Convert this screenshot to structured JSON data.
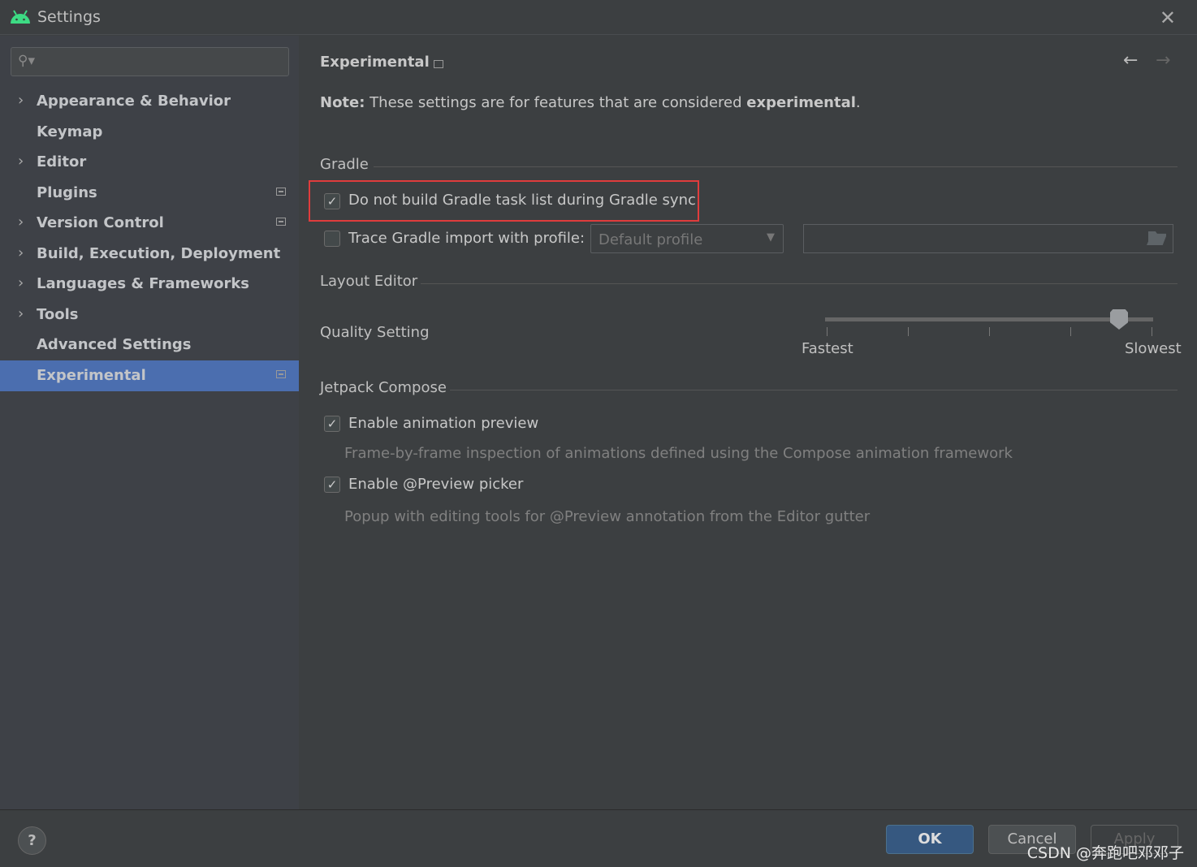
{
  "window": {
    "title": "Settings",
    "close_icon": "close-icon",
    "logo": "android-icon",
    "accent": "#3ddc84"
  },
  "sidebar": {
    "search_placeholder": "",
    "items": [
      {
        "label": "Appearance & Behavior",
        "expandable": true,
        "badge": false
      },
      {
        "label": "Keymap",
        "expandable": false,
        "badge": false
      },
      {
        "label": "Editor",
        "expandable": true,
        "badge": false
      },
      {
        "label": "Plugins",
        "expandable": false,
        "badge": true
      },
      {
        "label": "Version Control",
        "expandable": true,
        "badge": true
      },
      {
        "label": "Build, Execution, Deployment",
        "expandable": true,
        "badge": false
      },
      {
        "label": "Languages & Frameworks",
        "expandable": true,
        "badge": false
      },
      {
        "label": "Tools",
        "expandable": true,
        "badge": false
      },
      {
        "label": "Advanced Settings",
        "expandable": false,
        "badge": false
      },
      {
        "label": "Experimental",
        "expandable": false,
        "badge": true,
        "selected": true
      }
    ],
    "selected_color": "#4b6eaf"
  },
  "main": {
    "title": "Experimental",
    "note_bold": "Note:",
    "note_text": " These settings are for features that are considered ",
    "note_bold2": "experimental",
    "note_end": ".",
    "gradle": {
      "title": "Gradle",
      "no_task_list": {
        "label": "Do not build Gradle task list during Gradle sync",
        "checked": true,
        "highlight": "#e03c3c"
      },
      "trace": {
        "label": "Trace Gradle import with profile:",
        "checked": false,
        "profile": "Default profile",
        "path": ""
      }
    },
    "layout_editor": {
      "title": "Layout Editor",
      "quality_label": "Quality Setting",
      "min_label": "Fastest",
      "max_label": "Slowest",
      "value_percent": 90,
      "ticks": 5
    },
    "compose": {
      "title": "Jetpack Compose",
      "animation": {
        "label": "Enable animation preview",
        "checked": true,
        "hint": "Frame-by-frame inspection of animations defined using the Compose animation framework"
      },
      "picker": {
        "label": "Enable @Preview picker",
        "checked": true,
        "hint": "Popup with editing tools for @Preview annotation from the Editor gutter"
      }
    }
  },
  "footer": {
    "help": "?",
    "ok": "OK",
    "cancel": "Cancel",
    "apply": "Apply",
    "watermark": "CSDN @奔跑吧邓邓子"
  }
}
